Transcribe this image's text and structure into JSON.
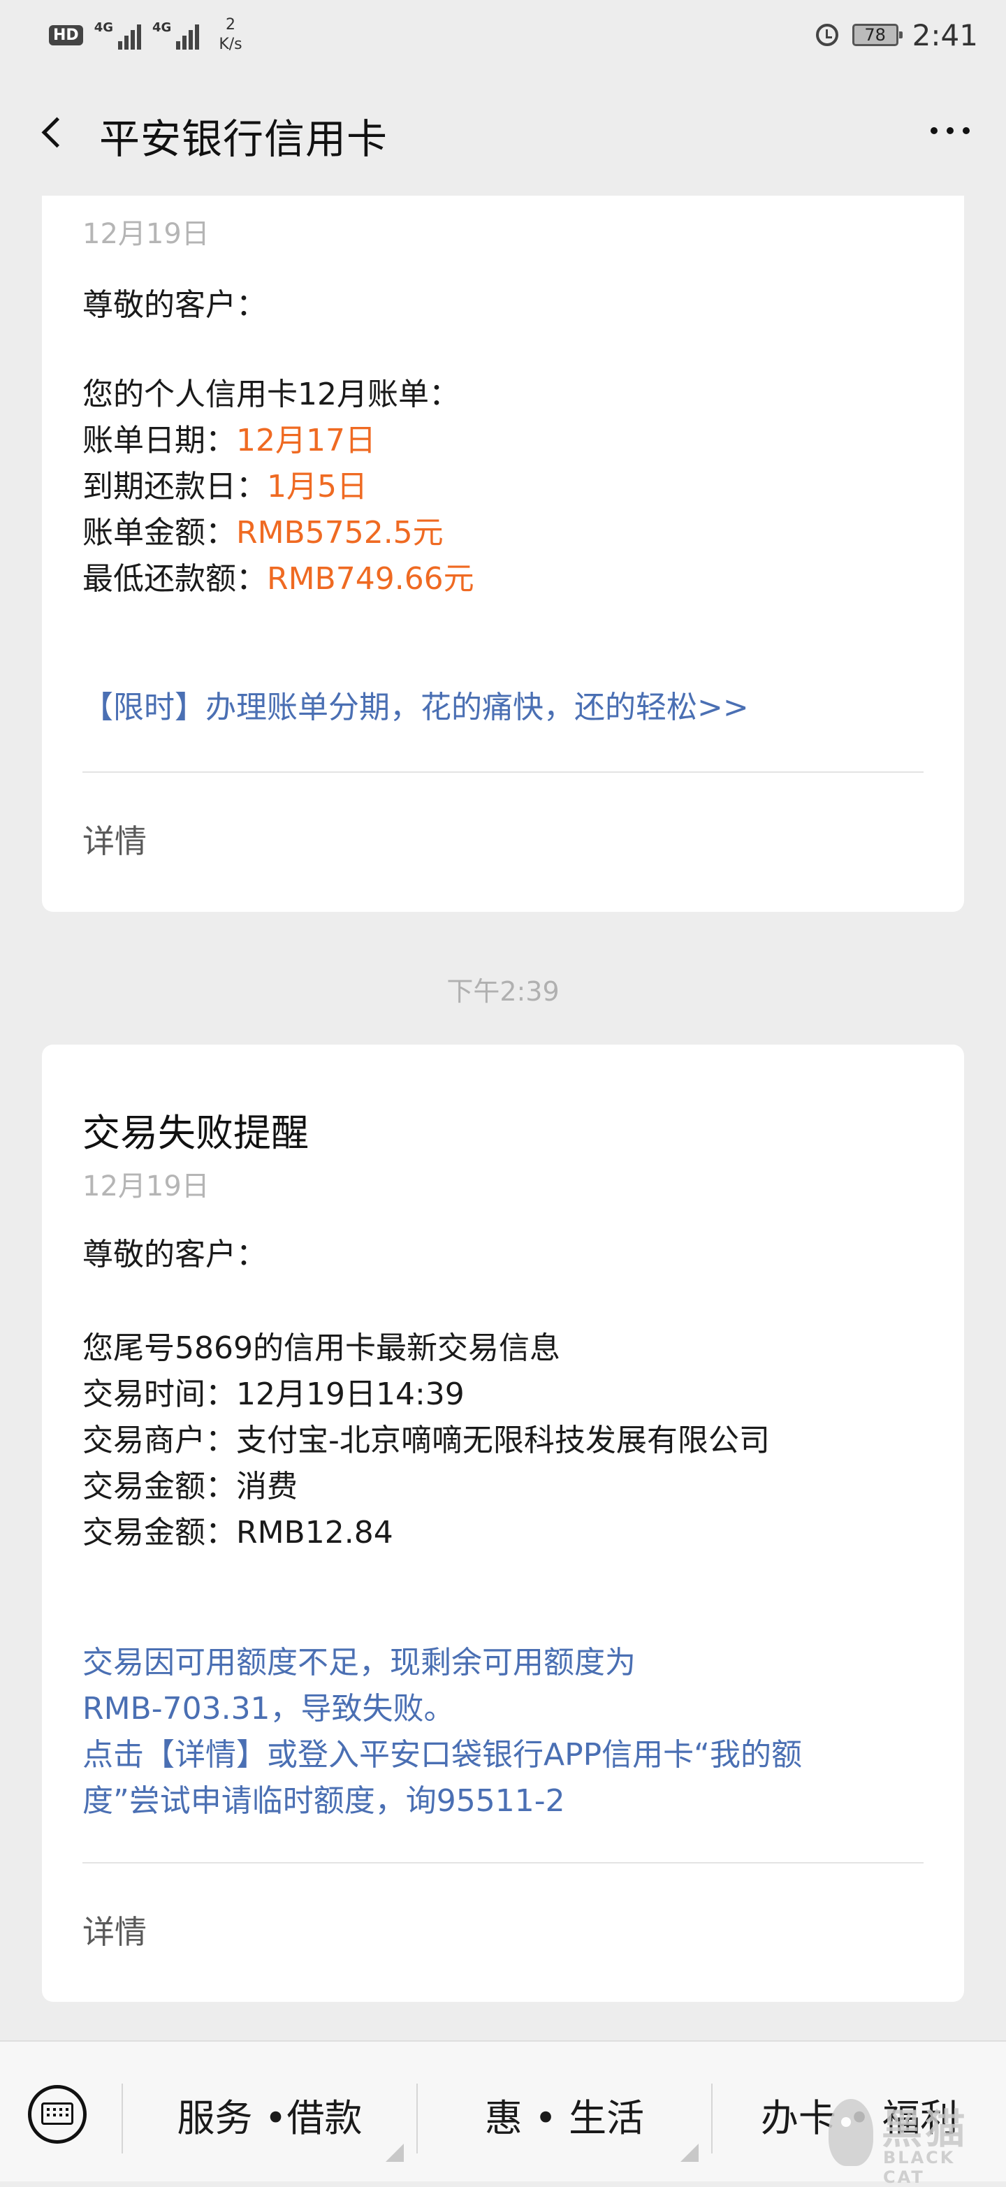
{
  "status_bar": {
    "hd": "HD",
    "network1": "4G",
    "network2": "4G",
    "speed_value": "2",
    "speed_unit": "K/s",
    "battery": "78",
    "time": "2:41"
  },
  "header": {
    "title": "平安银行信用卡"
  },
  "card1": {
    "date": "12月19日",
    "greeting": "尊敬的客户：",
    "intro": "您的个人信用卡12月账单：",
    "fields": [
      {
        "label": "账单日期：",
        "value": "12月17日"
      },
      {
        "label": "到期还款日：",
        "value": "1月5日"
      },
      {
        "label": "账单金额：",
        "value": "RMB5752.5元"
      },
      {
        "label": "最低还款额：",
        "value": "RMB749.66元"
      }
    ],
    "promo_link": "【限时】办理账单分期，花的痛快，还的轻松>>",
    "detail": "详情"
  },
  "time_separator": "下午2:39",
  "card2": {
    "title": "交易失败提醒",
    "date": "12月19日",
    "greeting": "尊敬的客户：",
    "lines": [
      "您尾号5869的信用卡最新交易信息",
      "交易时间：12月19日14:39",
      "交易商户：支付宝-北京嘀嘀无限科技发展有限公司",
      "交易金额：消费",
      "交易金额：RMB12.84"
    ],
    "notice_1": "交易因可用额度不足，现剩余可用额度为",
    "notice_2": "RMB-703.31，导致失败。",
    "notice_3": "点击【详情】或登入平安口袋银行APP信用卡“我的额",
    "notice_4": "度”尝试申请临时额度，询95511-2",
    "detail": "详情"
  },
  "bottom_menu": {
    "items": [
      "服务 •借款",
      "惠 • 生活",
      "办卡 • 福利"
    ]
  },
  "watermark": {
    "zh": "黑猫",
    "en": "BLACK CAT"
  },
  "colors": {
    "highlight": "#ef6a22",
    "link": "#4a6fb3"
  }
}
